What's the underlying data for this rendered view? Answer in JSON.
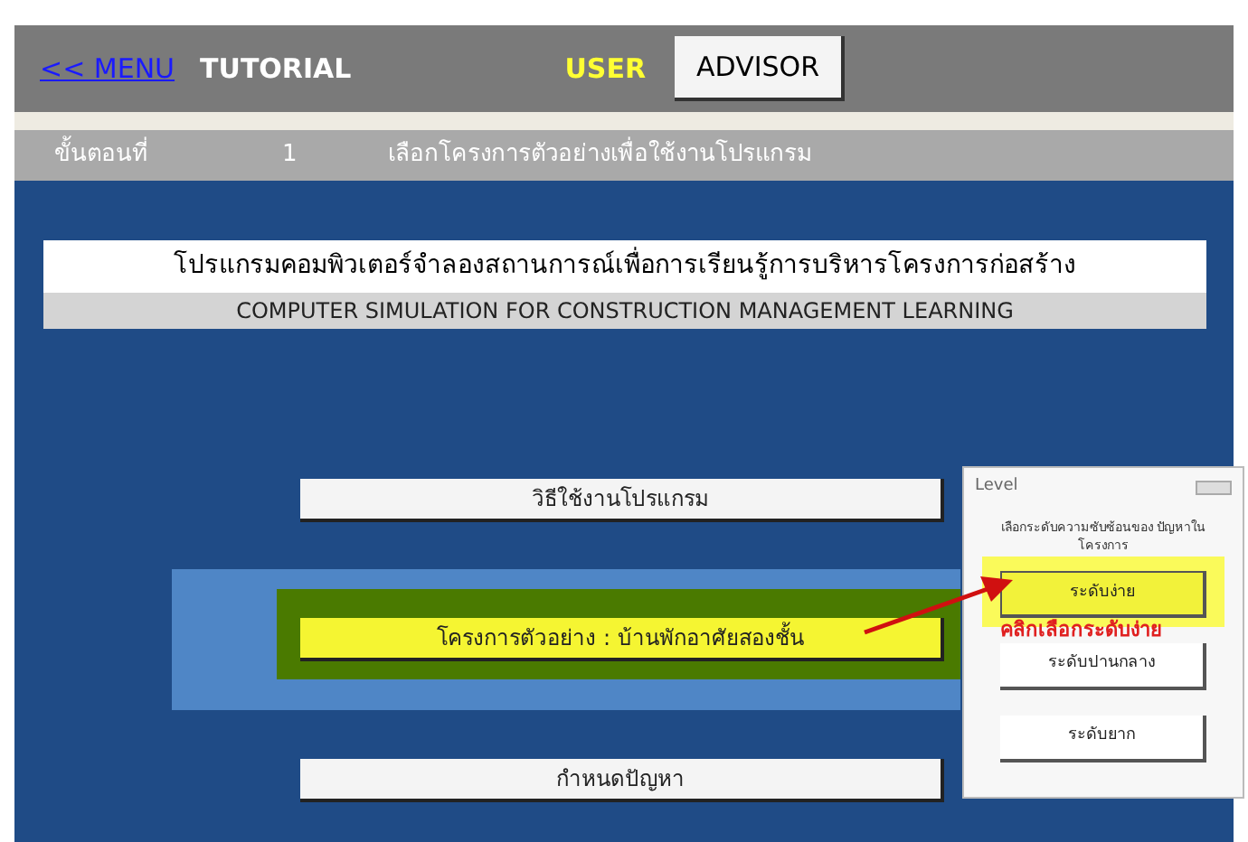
{
  "header": {
    "menu_link": "<< MENU",
    "title": "TUTORIAL",
    "user_label": "USER",
    "advisor_button": "ADVISOR"
  },
  "step": {
    "label": "ขั้นตอนที่",
    "number": "1",
    "description": "เลือกโครงการตัวอย่างเพื่อใช้งานโปรแกรม"
  },
  "program_title": {
    "thai": "โปรแกรมคอมพิวเตอร์จำลองสถานการณ์เพื่อการเรียนรู้การบริหารโครงการก่อสร้าง",
    "english": "COMPUTER SIMULATION FOR CONSTRUCTION MANAGEMENT LEARNING"
  },
  "menu_items": [
    {
      "label": "วิธีใช้งานโปรแกรม",
      "selected": false
    },
    {
      "label": "โครงการตัวอย่าง : บ้านพักอาศัยสองชั้น",
      "selected": true
    },
    {
      "label": "กำหนดปัญหา",
      "selected": false
    }
  ],
  "level_dialog": {
    "title": "Level",
    "prompt": "เลือกระดับความซับซ้อนของ ปัญหาในโครงการ",
    "options": [
      {
        "label": "ระดับง่าย",
        "selected": true
      },
      {
        "label": "ระดับปานกลาง",
        "selected": false
      },
      {
        "label": "ระดับยาก",
        "selected": false
      }
    ]
  },
  "annotation": "คลิกเลือกระดับง่าย"
}
